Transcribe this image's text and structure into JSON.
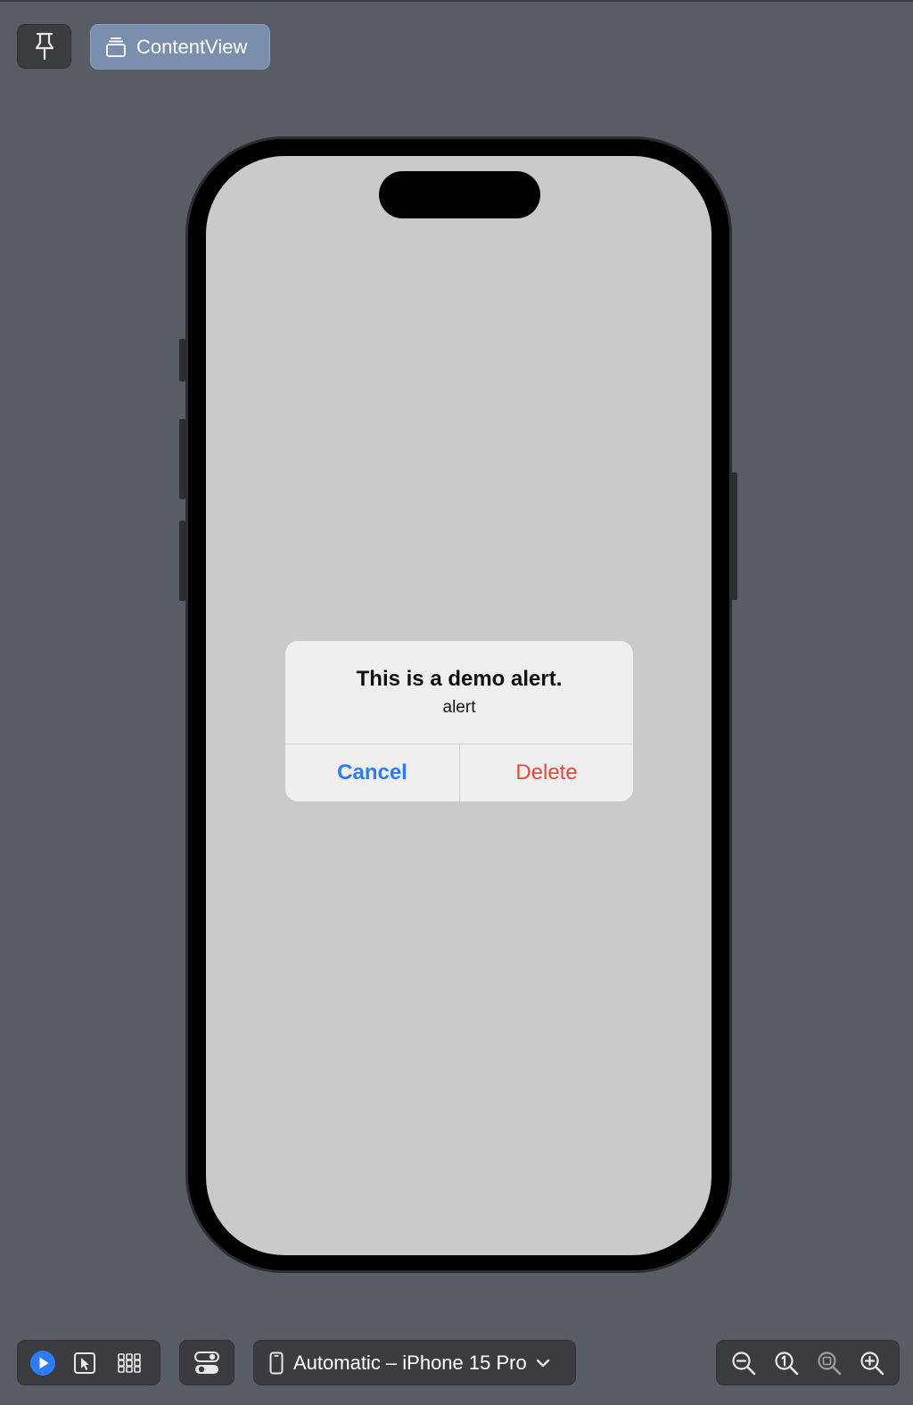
{
  "toolbar": {
    "pin_icon": "pin-icon",
    "content_view_label": "ContentView",
    "content_view_icon": "stack-window-icon"
  },
  "alert": {
    "title": "This is a demo alert.",
    "message": "alert",
    "cancel_label": "Cancel",
    "delete_label": "Delete"
  },
  "bottom_bar": {
    "modes": [
      "play-mode-icon",
      "selectable-mode-icon",
      "variants-grid-icon"
    ],
    "device_settings_icon": "device-settings-icon",
    "device_label": "Automatic – iPhone 15 Pro",
    "zoom": [
      "zoom-out-icon",
      "zoom-actual-size-icon",
      "zoom-to-fit-icon",
      "zoom-in-icon"
    ]
  },
  "colors": {
    "canvas": "#585c64",
    "accent_blue": "#2f7bf5",
    "destructive_red": "#e4493a",
    "selected_tab": "#7a8fad"
  }
}
